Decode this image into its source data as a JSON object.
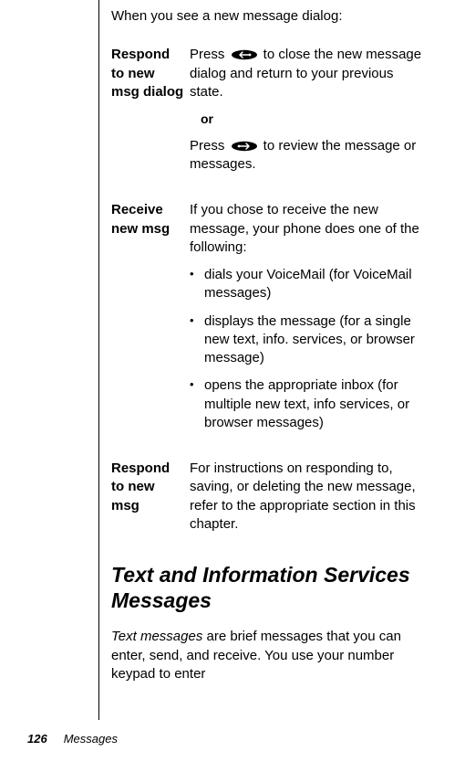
{
  "intro": "When you see a new message dialog:",
  "rows": [
    {
      "label": "Respond to new msg dialog",
      "p1a": "Press ",
      "p1b": " to close the new message dialog and return to your previous state.",
      "or": "or",
      "p2a": "Press ",
      "p2b": " to review the message or messages."
    },
    {
      "label": "Receive new msg",
      "p1": "If you chose to receive the new message, your phone does one of the following:",
      "bullets": [
        "dials your VoiceMail (for VoiceMail messages)",
        "displays the message (for a single new text, info. services, or browser message)",
        "opens the appropriate inbox (for multiple new text, info services, or browser messages)"
      ]
    },
    {
      "label": "Respond to new msg",
      "p1": "For instructions on responding to, saving, or deleting the new message, refer to the appropriate section in this chapter."
    }
  ],
  "section_heading": "Text and Information Services Messages",
  "body_em": "Text messages",
  "body_rest": " are brief messages that you can enter, send, and receive. You use your number keypad to enter",
  "footer": {
    "page": "126",
    "title": "Messages"
  }
}
